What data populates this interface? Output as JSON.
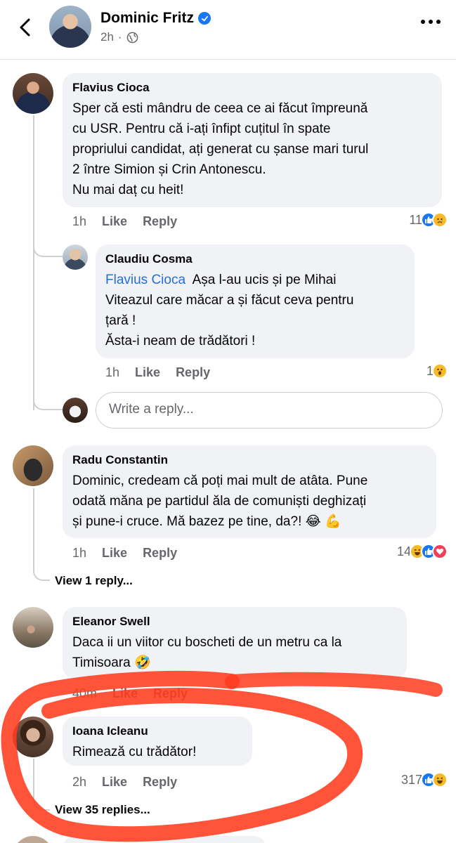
{
  "header": {
    "name": "Dominic Fritz",
    "time": "2h",
    "verified": true,
    "privacy_icon": "globe-icon"
  },
  "comments": [
    {
      "author": "Flavius Cioca",
      "lines": [
        "Sper că esti mândru de ceea ce ai făcut împreună",
        "cu USR. Pentru că i-ați înfipt cuțitul în spate",
        "propriului candidat, ați generat cu șanse mari turul",
        "2 între Simion și Crin Antonescu.",
        "Nu mai daț cu heit!"
      ],
      "time": "1h",
      "like": "Like",
      "reply": "Reply",
      "reaction_count": "11",
      "reactions": [
        "like",
        "sad"
      ]
    },
    {
      "author": "Claudiu Cosma",
      "mention": "Flavius Cioca",
      "lines": [
        "Așa l-au ucis și pe Mihai",
        "Viteazul care măcar a și făcut ceva pentru",
        "țară !",
        "Ăsta-i  neam de trădători !"
      ],
      "time": "1h",
      "like": "Like",
      "reply": "Reply",
      "reaction_count": "1",
      "reactions": [
        "wow"
      ]
    },
    {
      "author": "Radu Constantin",
      "lines": [
        "Dominic, credeam că poți mai mult de atâta. Pune",
        "odată măna pe partidul ăla de comuniști deghizați",
        "și pune-i cruce. Mă bazez pe tine, da?! 😂 💪"
      ],
      "time": "1h",
      "like": "Like",
      "reply": "Reply",
      "reaction_count": "14",
      "reactions": [
        "haha",
        "like",
        "love"
      ],
      "view_replies": "View 1 reply..."
    },
    {
      "author": "Eleanor Swell",
      "lines": [
        "Daca ii un viitor cu boscheti de un metru ca la",
        "Timisoara 🤣"
      ],
      "time": "40m",
      "like": "Like",
      "reply": "Reply"
    },
    {
      "author": "Ioana Icleanu",
      "lines": [
        "Rimează cu trădător!"
      ],
      "time": "2h",
      "like": "Like",
      "reply": "Reply",
      "reaction_count": "317",
      "reactions": [
        "like",
        "haha"
      ],
      "view_replies": "View 35 replies..."
    }
  ],
  "write_reply_placeholder": "Write a reply...",
  "colors": {
    "annotation_marker": "#ff3b1f",
    "link": "#216fdb",
    "bubble": "#f0f2f5"
  }
}
